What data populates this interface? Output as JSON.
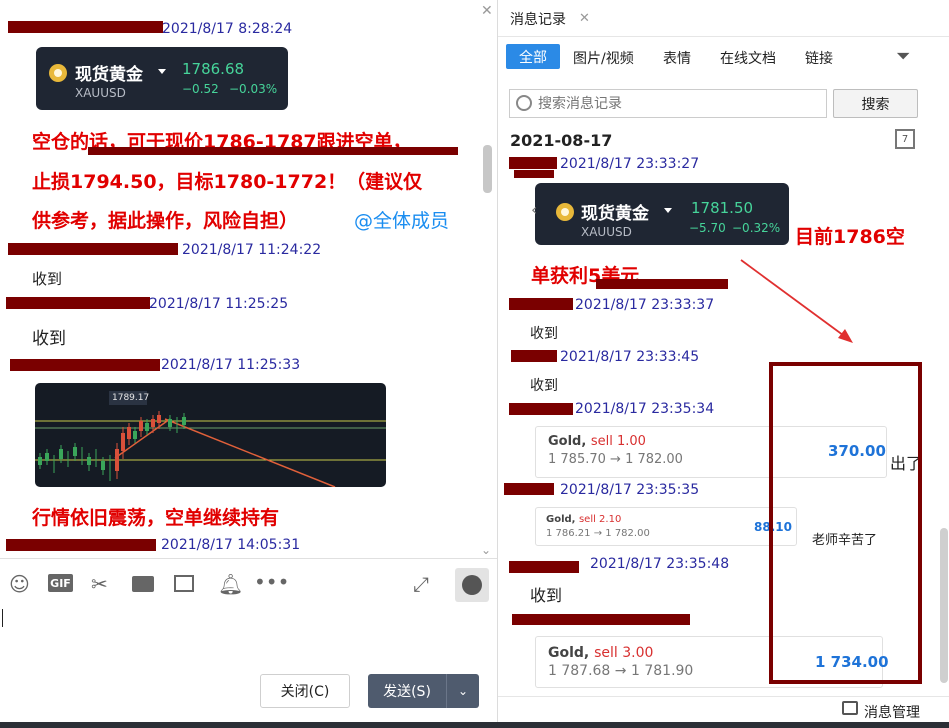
{
  "left_chat": {
    "messages": [
      {
        "time": "2021/8/17 8:28:24"
      },
      {
        "time": "2021/8/17 11:24:22",
        "text": "收到"
      },
      {
        "time": "2021/8/17 11:25:25",
        "text": "收到"
      },
      {
        "time": "2021/8/17 11:25:33"
      },
      {
        "time": "2021/8/17 14:05:31"
      }
    ],
    "quote_card": {
      "name": "现货黄金",
      "code": "XAUUSD",
      "price": "1786.68",
      "change": "−0.52",
      "change_pct": "−0.03%"
    },
    "analysis_lines": [
      "空仓的话，可于现价1786-1787跟进空单，",
      "止损1794.50，目标1780-1772！（建议仅",
      "供参考，据此操作，风险自担）"
    ],
    "mention": "@全体成员",
    "chart_price_tag": "1789.17",
    "status_text": "行情依旧震荡，空单继续持有",
    "close_button": "关闭(C)",
    "send_button": "发送(S)"
  },
  "right_panel": {
    "tab_title": "消息记录",
    "filters": [
      "全部",
      "图片/视频",
      "表情",
      "在线文档",
      "链接"
    ],
    "search_placeholder": "搜索消息记录",
    "search_button": "搜索",
    "date_header": "2021-08-17",
    "quote_card": {
      "name": "现货黄金",
      "code": "XAUUSD",
      "price": "1781.50",
      "change": "−5.70",
      "change_pct": "−0.32%"
    },
    "annotation_lines": [
      "目前1786空",
      "单获利5美元"
    ],
    "messages": [
      {
        "time": "2021/8/17 23:33:27"
      },
      {
        "time": "2021/8/17 23:33:37",
        "text": "收到"
      },
      {
        "time": "2021/8/17 23:33:45",
        "text": "收到"
      },
      {
        "time": "2021/8/17 23:35:34"
      },
      {
        "time": "2021/8/17 23:35:35"
      },
      {
        "time": "2021/8/17 23:35:48",
        "text": "收到"
      }
    ],
    "trade_cards": [
      {
        "symbol": "Gold,",
        "side": "sell 1.00",
        "from": "1 785.70",
        "to": "1 782.00",
        "profit": "370.00"
      },
      {
        "symbol": "Gold,",
        "side": "sell 2.10",
        "from": "1 786.21",
        "to": "1 782.00",
        "profit": "88.10"
      },
      {
        "symbol": "Gold,",
        "side": "sell 3.00",
        "from": "1 787.68",
        "to": "1 781.90",
        "profit": "1 734.00"
      }
    ],
    "side_text_1": "出了",
    "side_text_2": "老师辛苦了",
    "manage_label": "消息管理"
  }
}
